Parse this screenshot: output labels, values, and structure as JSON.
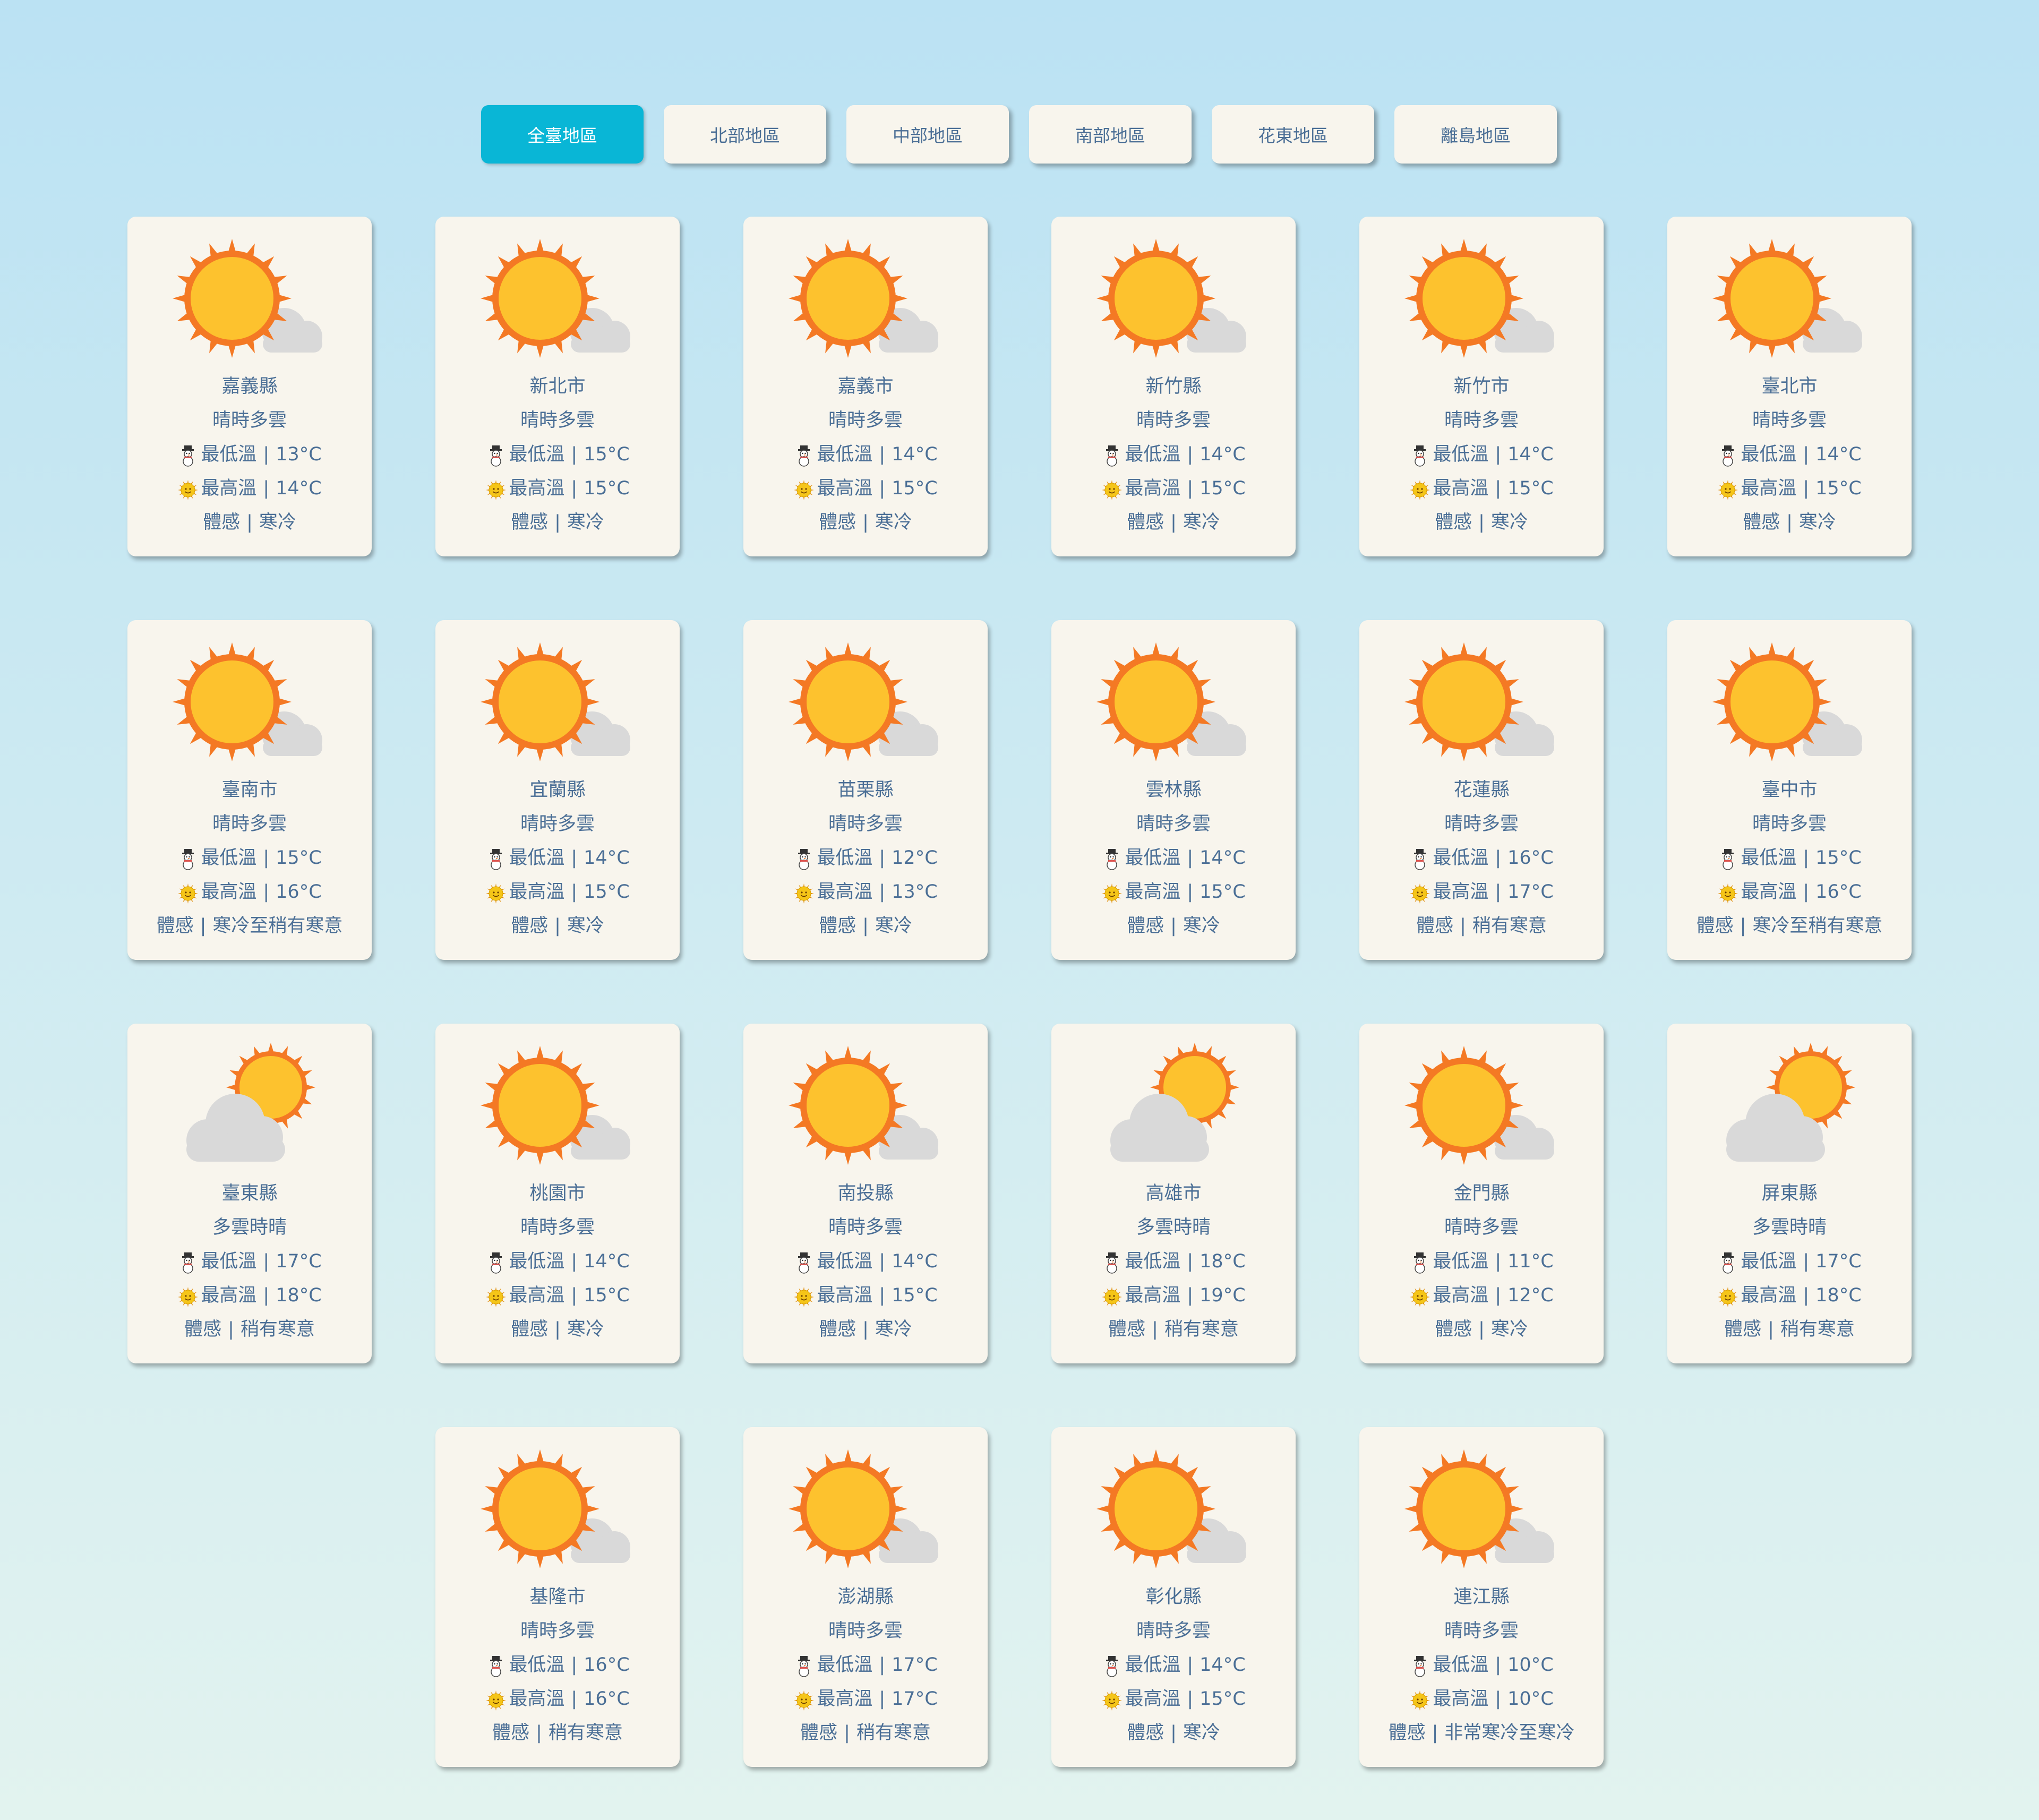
{
  "tabs": [
    {
      "label": "全臺地區",
      "active": true
    },
    {
      "label": "北部地區",
      "active": false
    },
    {
      "label": "中部地區",
      "active": false
    },
    {
      "label": "南部地區",
      "active": false
    },
    {
      "label": "花東地區",
      "active": false
    },
    {
      "label": "離島地區",
      "active": false
    }
  ],
  "labels": {
    "min": "最低溫",
    "max": "最高溫",
    "feel": "體感",
    "separator": "|"
  },
  "icons": {
    "sun_cloud": "sun-behind-cloud-icon",
    "cloud_sun": "cloud-with-sun-icon",
    "snowman": "snowman-icon",
    "sun_face": "sun-face-icon"
  },
  "colors": {
    "active_tab": "#09b6d6",
    "card_bg": "#f8f5ed",
    "text": "#4b6f96",
    "sun": "#fdc22e",
    "sun_rays": "#f47924",
    "cloud": "#d9d9d9"
  },
  "cards": [
    {
      "city": "嘉義縣",
      "weather": "晴時多雲",
      "min": "13°C",
      "max": "14°C",
      "feel": "寒冷",
      "icon": "sun_cloud"
    },
    {
      "city": "新北市",
      "weather": "晴時多雲",
      "min": "15°C",
      "max": "15°C",
      "feel": "寒冷",
      "icon": "sun_cloud"
    },
    {
      "city": "嘉義市",
      "weather": "晴時多雲",
      "min": "14°C",
      "max": "15°C",
      "feel": "寒冷",
      "icon": "sun_cloud"
    },
    {
      "city": "新竹縣",
      "weather": "晴時多雲",
      "min": "14°C",
      "max": "15°C",
      "feel": "寒冷",
      "icon": "sun_cloud"
    },
    {
      "city": "新竹市",
      "weather": "晴時多雲",
      "min": "14°C",
      "max": "15°C",
      "feel": "寒冷",
      "icon": "sun_cloud"
    },
    {
      "city": "臺北市",
      "weather": "晴時多雲",
      "min": "14°C",
      "max": "15°C",
      "feel": "寒冷",
      "icon": "sun_cloud"
    },
    {
      "city": "臺南市",
      "weather": "晴時多雲",
      "min": "15°C",
      "max": "16°C",
      "feel": "寒冷至稍有寒意",
      "icon": "sun_cloud"
    },
    {
      "city": "宜蘭縣",
      "weather": "晴時多雲",
      "min": "14°C",
      "max": "15°C",
      "feel": "寒冷",
      "icon": "sun_cloud"
    },
    {
      "city": "苗栗縣",
      "weather": "晴時多雲",
      "min": "12°C",
      "max": "13°C",
      "feel": "寒冷",
      "icon": "sun_cloud"
    },
    {
      "city": "雲林縣",
      "weather": "晴時多雲",
      "min": "14°C",
      "max": "15°C",
      "feel": "寒冷",
      "icon": "sun_cloud"
    },
    {
      "city": "花蓮縣",
      "weather": "晴時多雲",
      "min": "16°C",
      "max": "17°C",
      "feel": "稍有寒意",
      "icon": "sun_cloud"
    },
    {
      "city": "臺中市",
      "weather": "晴時多雲",
      "min": "15°C",
      "max": "16°C",
      "feel": "寒冷至稍有寒意",
      "icon": "sun_cloud"
    },
    {
      "city": "臺東縣",
      "weather": "多雲時晴",
      "min": "17°C",
      "max": "18°C",
      "feel": "稍有寒意",
      "icon": "cloud_sun"
    },
    {
      "city": "桃園市",
      "weather": "晴時多雲",
      "min": "14°C",
      "max": "15°C",
      "feel": "寒冷",
      "icon": "sun_cloud"
    },
    {
      "city": "南投縣",
      "weather": "晴時多雲",
      "min": "14°C",
      "max": "15°C",
      "feel": "寒冷",
      "icon": "sun_cloud"
    },
    {
      "city": "高雄市",
      "weather": "多雲時晴",
      "min": "18°C",
      "max": "19°C",
      "feel": "稍有寒意",
      "icon": "cloud_sun"
    },
    {
      "city": "金門縣",
      "weather": "晴時多雲",
      "min": "11°C",
      "max": "12°C",
      "feel": "寒冷",
      "icon": "sun_cloud"
    },
    {
      "city": "屏東縣",
      "weather": "多雲時晴",
      "min": "17°C",
      "max": "18°C",
      "feel": "稍有寒意",
      "icon": "cloud_sun"
    },
    {
      "city": "基隆市",
      "weather": "晴時多雲",
      "min": "16°C",
      "max": "16°C",
      "feel": "稍有寒意",
      "icon": "sun_cloud"
    },
    {
      "city": "澎湖縣",
      "weather": "晴時多雲",
      "min": "17°C",
      "max": "17°C",
      "feel": "稍有寒意",
      "icon": "sun_cloud"
    },
    {
      "city": "彰化縣",
      "weather": "晴時多雲",
      "min": "14°C",
      "max": "15°C",
      "feel": "寒冷",
      "icon": "sun_cloud"
    },
    {
      "city": "連江縣",
      "weather": "晴時多雲",
      "min": "10°C",
      "max": "10°C",
      "feel": "非常寒冷至寒冷",
      "icon": "sun_cloud"
    }
  ]
}
